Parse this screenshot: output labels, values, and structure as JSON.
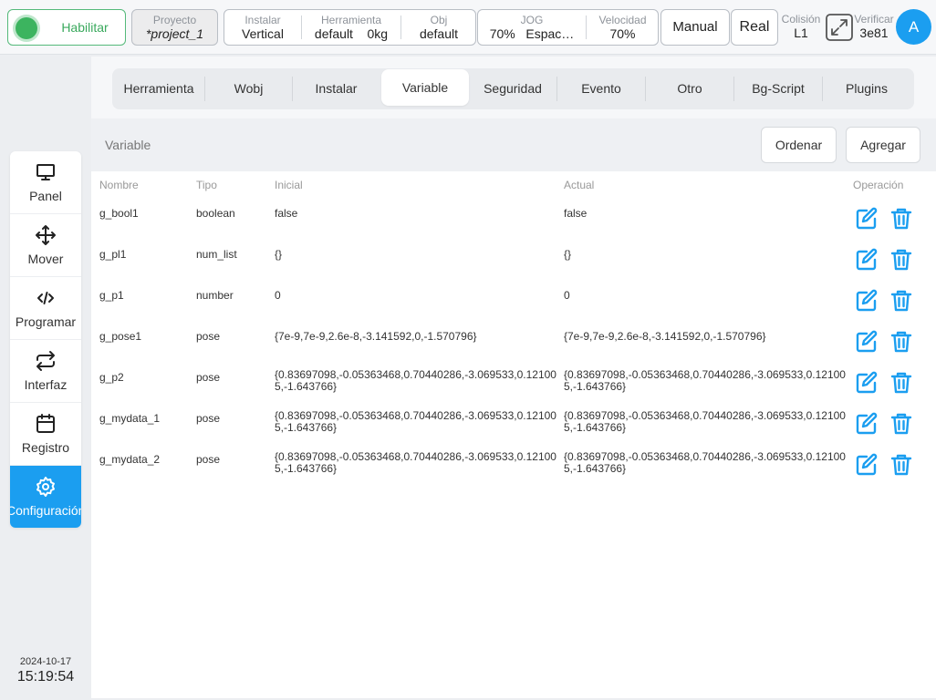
{
  "header": {
    "enable_label": "Habilitar",
    "project": {
      "label": "Proyecto",
      "value": "*project_1"
    },
    "install": {
      "label": "Instalar",
      "value": "Vertical"
    },
    "tool": {
      "label": "Herramienta",
      "value": "default",
      "payload": "0kg"
    },
    "obj": {
      "label": "Obj",
      "value": "default"
    },
    "jog": {
      "label": "JOG",
      "value": "70%",
      "mode": "Espac…"
    },
    "speed": {
      "label": "Velocidad",
      "value": "70%"
    },
    "manual_label": "Manual",
    "real_label": "Real",
    "collision": {
      "label": "Colisión",
      "value": "L1"
    },
    "verify": {
      "label": "Verificar",
      "value": "3e81"
    },
    "avatar_initial": "A"
  },
  "sidebar": {
    "items": [
      {
        "label": "Panel",
        "icon": "monitor-icon"
      },
      {
        "label": "Mover",
        "icon": "move-arrows-icon"
      },
      {
        "label": "Programar",
        "icon": "code-icon"
      },
      {
        "label": "Interfaz",
        "icon": "swap-arrows-icon"
      },
      {
        "label": "Registro",
        "icon": "calendar-icon"
      },
      {
        "label": "Configuración",
        "icon": "gear-icon",
        "active": true
      }
    ],
    "date": "2024-10-17",
    "time": "15:19:54"
  },
  "tabs": [
    "Herramienta",
    "Wobj",
    "Instalar",
    "Variable",
    "Seguridad",
    "Evento",
    "Otro",
    "Bg-Script",
    "Plugins"
  ],
  "active_tab": "Variable",
  "toolbar": {
    "title": "Variable",
    "sort_label": "Ordenar",
    "add_label": "Agregar"
  },
  "table": {
    "columns": {
      "name": "Nombre",
      "type": "Tipo",
      "initial": "Inicial",
      "actual": "Actual",
      "operation": "Operación"
    },
    "rows": [
      {
        "name": "g_bool1",
        "type": "boolean",
        "initial": "false",
        "actual": "false"
      },
      {
        "name": "g_pl1",
        "type": "num_list",
        "initial": "{}",
        "actual": "{}"
      },
      {
        "name": "g_p1",
        "type": "number",
        "initial": "0",
        "actual": "0"
      },
      {
        "name": "g_pose1",
        "type": "pose",
        "initial": "{7e-9,7e-9,2.6e-8,-3.141592,0,-1.570796}",
        "actual": "{7e-9,7e-9,2.6e-8,-3.141592,0,-1.570796}"
      },
      {
        "name": "g_p2",
        "type": "pose",
        "initial": "{0.83697098,-0.05363468,0.70440286,-3.069533,0.121005,-1.643766}",
        "actual": "{0.83697098,-0.05363468,0.70440286,-3.069533,0.121005,-1.643766}"
      },
      {
        "name": "g_mydata_1",
        "type": "pose",
        "initial": "{0.83697098,-0.05363468,0.70440286,-3.069533,0.121005,-1.643766}",
        "actual": "{0.83697098,-0.05363468,0.70440286,-3.069533,0.121005,-1.643766}"
      },
      {
        "name": "g_mydata_2",
        "type": "pose",
        "initial": "{0.83697098,-0.05363468,0.70440286,-3.069533,0.121005,-1.643766}",
        "actual": "{0.83697098,-0.05363468,0.70440286,-3.069533,0.121005,-1.643766}"
      }
    ]
  },
  "colors": {
    "accent": "#1B9EF0",
    "enabled_green": "#3CB45F"
  }
}
